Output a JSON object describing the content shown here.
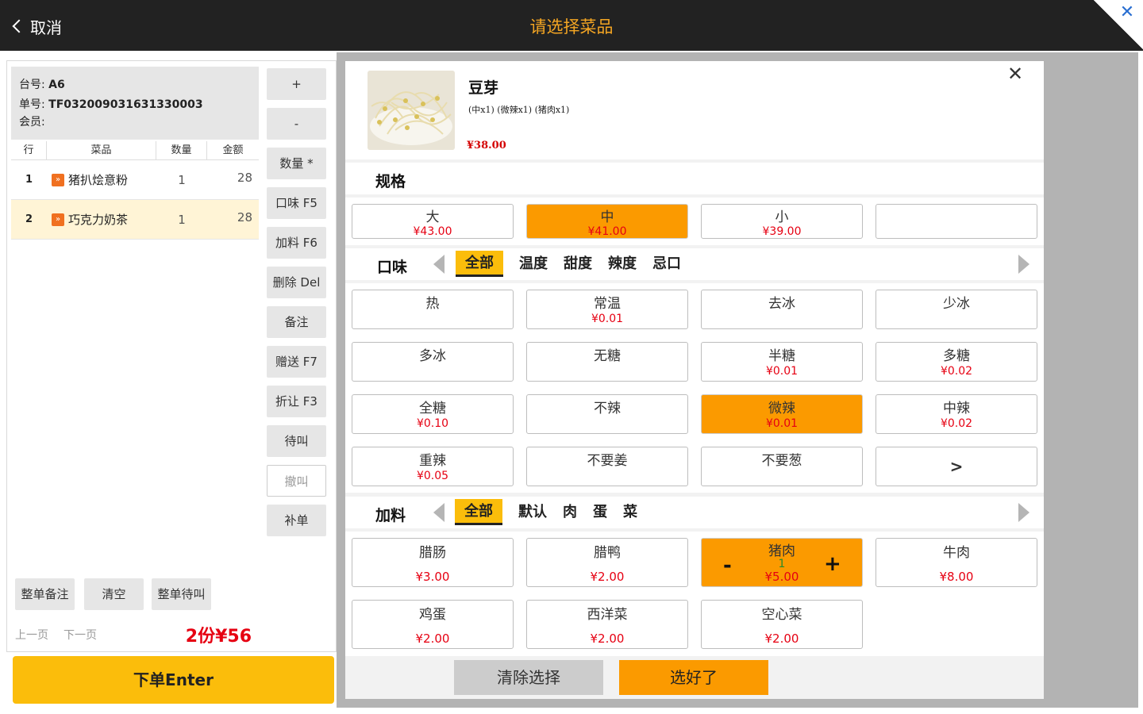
{
  "topbar": {
    "cancel_label": "取消",
    "title": "请选择菜品",
    "close_glyph": "✕"
  },
  "order": {
    "table_label": "台号:",
    "table_value": "A6",
    "order_label": "单号:",
    "order_value": "TF032009031631330003",
    "member_label": "会员:",
    "columns": [
      "行",
      "菜品",
      "数量",
      "金额"
    ],
    "rows": [
      {
        "no": "1",
        "tag": "»",
        "name": "猪扒烩意粉",
        "qty": "1",
        "amount": "28"
      },
      {
        "no": "2",
        "tag": "»",
        "name": "巧克力奶茶",
        "qty": "1",
        "amount": "28"
      }
    ],
    "side_buttons": [
      "+",
      "-",
      "数量 *",
      "口味 F5",
      "加料 F6",
      "删除 Del",
      "备注",
      "赠送 F7",
      "折让 F3",
      "待叫",
      "撤叫",
      "补单"
    ],
    "bottom_buttons": [
      "整单备注",
      "清空",
      "整单待叫"
    ],
    "prev_page": "上一页",
    "next_page": "下一页",
    "total": "2份¥56",
    "submit_label": "下单Enter"
  },
  "dish": {
    "name": "豆芽",
    "summary": "(中x1) (微辣x1) (猪肉x1)",
    "price": "¥38.00",
    "close_glyph": "✕"
  },
  "spec": {
    "title": "规格",
    "options": [
      {
        "name": "大",
        "price": "¥43.00"
      },
      {
        "name": "中",
        "price": "¥41.00"
      },
      {
        "name": "小",
        "price": "¥39.00"
      },
      {
        "name": "",
        "price": ""
      }
    ]
  },
  "taste": {
    "title": "口味",
    "tabs": [
      "全部",
      "温度",
      "甜度",
      "辣度",
      "忌口"
    ],
    "options": [
      {
        "name": "热",
        "price": ""
      },
      {
        "name": "常温",
        "price": "¥0.01"
      },
      {
        "name": "去冰",
        "price": ""
      },
      {
        "name": "少冰",
        "price": ""
      },
      {
        "name": "多冰",
        "price": ""
      },
      {
        "name": "无糖",
        "price": ""
      },
      {
        "name": "半糖",
        "price": "¥0.01"
      },
      {
        "name": "多糖",
        "price": "¥0.02"
      },
      {
        "name": "全糖",
        "price": "¥0.10"
      },
      {
        "name": "不辣",
        "price": ""
      },
      {
        "name": "微辣",
        "price": "¥0.01"
      },
      {
        "name": "中辣",
        "price": "¥0.02"
      },
      {
        "name": "重辣",
        "price": "¥0.05"
      },
      {
        "name": "不要姜",
        "price": ""
      },
      {
        "name": "不要葱",
        "price": ""
      },
      {
        "name": ">",
        "price": ""
      }
    ]
  },
  "addon": {
    "title": "加料",
    "tabs": [
      "全部",
      "默认",
      "肉",
      "蛋",
      "菜"
    ],
    "options": [
      {
        "name": "腊肠",
        "price": "¥3.00"
      },
      {
        "name": "腊鸭",
        "price": "¥2.00"
      },
      {
        "name": "猪肉",
        "price": "¥5.00",
        "count": "1",
        "minus": "-",
        "plus": "+"
      },
      {
        "name": "牛肉",
        "price": "¥8.00"
      },
      {
        "name": "鸡蛋",
        "price": "¥2.00"
      },
      {
        "name": "西洋菜",
        "price": "¥2.00"
      },
      {
        "name": "空心菜",
        "price": "¥2.00"
      }
    ]
  },
  "footer": {
    "clear_label": "清除选择",
    "done_label": "选好了"
  },
  "colors": {
    "accent_orange": "#fb9a00",
    "accent_yellow": "#fbbd0b",
    "price_red": "#e60012",
    "title_gold": "#f5a623"
  }
}
